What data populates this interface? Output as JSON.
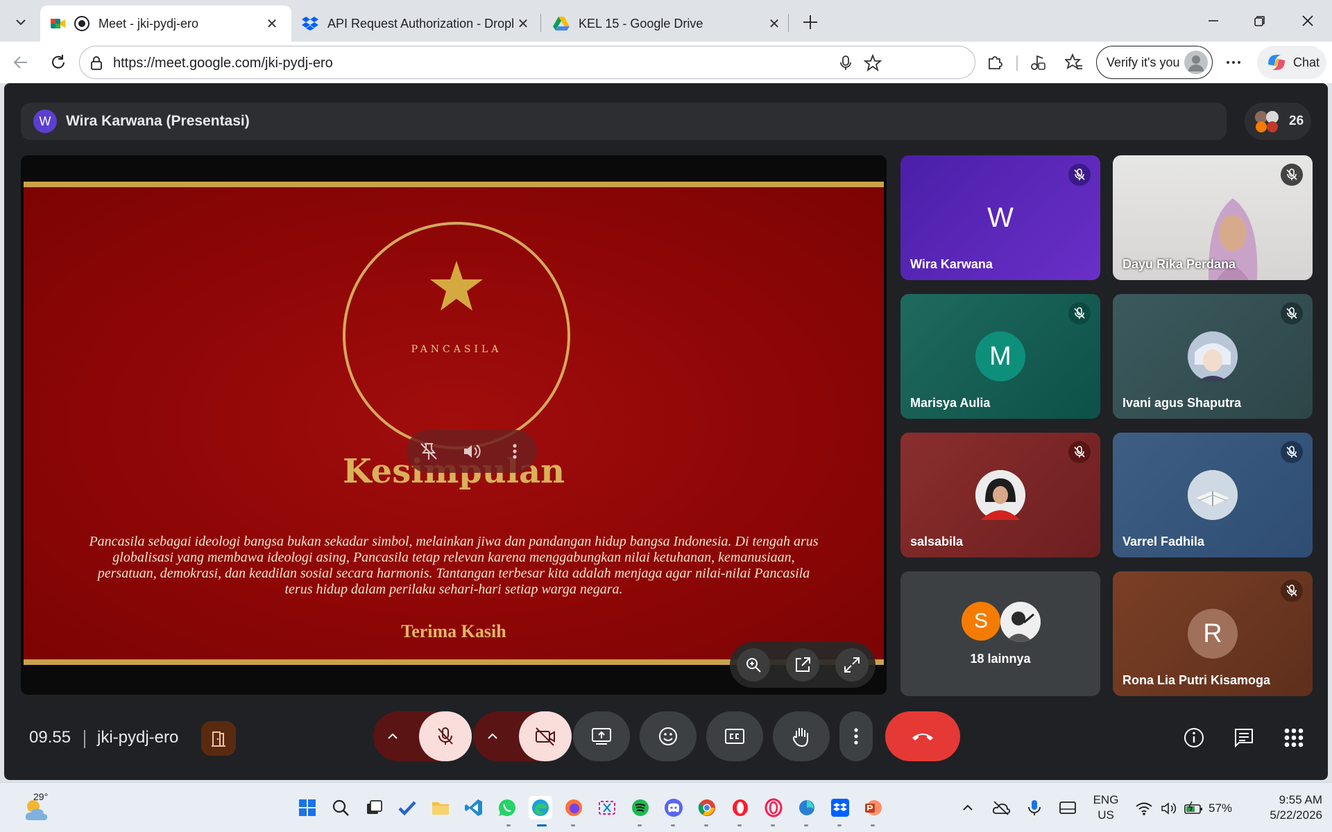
{
  "browser": {
    "tabs": [
      {
        "title": "Meet - jki-pydj-ero",
        "active": true
      },
      {
        "title": "API Request Authorization - Dropbox",
        "active": false
      },
      {
        "title": "KEL 15 - Google Drive",
        "active": false
      }
    ],
    "url": "https://meet.google.com/jki-pydj-ero",
    "verify_label": "Verify it's you",
    "chat_label": "Chat"
  },
  "meet": {
    "presenter_initial": "W",
    "presenter_title": "Wira Karwana (Presentasi)",
    "participant_count": "26",
    "slide": {
      "brand": "PANCASILA",
      "title": "Kesimpulan",
      "body": "Pancasila sebagai ideologi bangsa bukan sekadar simbol, melainkan jiwa dan pandangan hidup bangsa Indonesia. Di tengah arus globalisasi yang membawa ideologi asing, Pancasila tetap relevan karena menggabungkan nilai ketuhanan, kemanusiaan, persatuan, demokrasi, dan keadilan sosial secara harmonis. Tantangan terbesar kita adalah menjaga agar nilai-nilai Pancasila terus hidup dalam perilaku sehari-hari setiap warga negara.",
      "thanks": "Terima Kasih"
    },
    "participants": [
      {
        "name": "Wira Karwana",
        "initial": "W"
      },
      {
        "name": "Dayu Rika Perdana",
        "initial": ""
      },
      {
        "name": "Marisya Aulia",
        "initial": "M"
      },
      {
        "name": "Ivani agus Shaputra",
        "initial": ""
      },
      {
        "name": "salsabila",
        "initial": ""
      },
      {
        "name": "Varrel Fadhila",
        "initial": ""
      },
      {
        "name": "18 lainnya",
        "initial": "S"
      },
      {
        "name": "Rona Lia Putri Kisamoga",
        "initial": "R"
      }
    ],
    "time": "09.55",
    "meeting_code": "jki-pydj-ero",
    "colors": {
      "end_call": "#e53935",
      "mic_off": "#f9dedc",
      "slide_red": "#8e0606",
      "gold": "#d3aa5c"
    }
  },
  "taskbar": {
    "weather_temp": "29°",
    "lang_line1": "ENG",
    "lang_line2": "US",
    "battery": "57%",
    "time": "9:55 AM",
    "date": "5/22/2026"
  }
}
